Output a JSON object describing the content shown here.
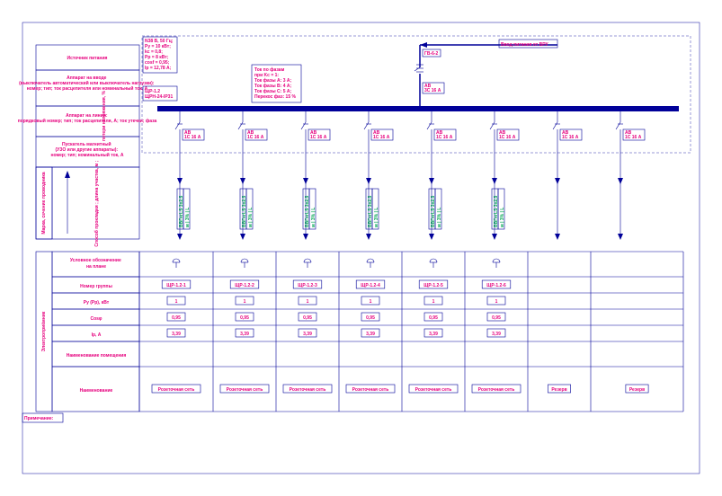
{
  "frame_label": "Примечание:",
  "rows": {
    "r1": "Источник питания",
    "r2": "Аппарат на вводе\n(выключатель автоматический или выключатель нагрузки):\nномер; тип; ток расцепителя или номинальный ток, А",
    "r3": "Аппарат на линии:\nпорядковый номер; тип; ток расцепителя, А; ток утечки; фаза",
    "r4": "Пускатель магнитный\n(УЗО или другие аппараты):\nномер; тип; номинальный ток, А",
    "r5a": "Марка, сечение проводника",
    "r5b": "Способ прокладки ; длина участка, м ;\nпотери напряжения, %",
    "tbl_section": "Электроприёмник",
    "t1": "Условное обозначение\nна плане",
    "t2": "Номер группы",
    "t3": "Ру (Рр), кВт",
    "t4": "Cosφ",
    "t5": "Iр, А",
    "t6": "Наименование помещения",
    "t7": "Наименование"
  },
  "input_block": {
    "l1": "N38 В, 50 Гц;",
    "l2": "Pу = 10 кВт;",
    "l3": "kс = 0,8;",
    "l4": "Pр = 8 кВт;",
    "l5": "cosf = 0,95;",
    "l6": "Iр = 12,78 А;"
  },
  "input_device": {
    "l1": "ЩР-1.2",
    "l2": "ЩРН-24-IP31"
  },
  "phase_block": {
    "l1": "Ток по фазам",
    "l2": "при Kc = 1:",
    "l3": "Ток фазы А: 3 А;",
    "l4": "Ток фазы В: 4 А;",
    "l5": "Ток фазы С: 5 А;",
    "l6": "Перекос фаз: 15 %"
  },
  "feed": {
    "label": "Ввод питания от ВРУ",
    "cable": "ГВ-6-2"
  },
  "breaker": {
    "l1": "АВ",
    "l2": "1С 16 А"
  },
  "cable_tag": {
    "l1": "ВВГнгLS 3х2,5",
    "l2": "м | 3% | L"
  },
  "chart_data": {
    "type": "table",
    "columns": [
      "ЩР-1.2-1",
      "ЩР-1.2-2",
      "ЩР-1.2-3",
      "ЩР-1.2-4",
      "ЩР-1.2-5",
      "ЩР-1.2-6",
      "",
      ""
    ],
    "rows": [
      {
        "name": "Номер группы",
        "values": [
          "ЩР-1.2-1",
          "ЩР-1.2-2",
          "ЩР-1.2-3",
          "ЩР-1.2-4",
          "ЩР-1.2-5",
          "ЩР-1.2-6",
          "",
          ""
        ]
      },
      {
        "name": "Ру (Рр), кВт",
        "values": [
          "1",
          "1",
          "1",
          "1",
          "1",
          "1",
          "",
          ""
        ]
      },
      {
        "name": "Cosφ",
        "values": [
          "0,95",
          "0,95",
          "0,95",
          "0,95",
          "0,95",
          "0,95",
          "",
          ""
        ]
      },
      {
        "name": "Iр, А",
        "values": [
          "3,39",
          "3,39",
          "3,39",
          "3,39",
          "3,39",
          "3,39",
          "",
          ""
        ]
      },
      {
        "name": "Наименование помещения",
        "values": [
          "",
          "",
          "",
          "",
          "",
          "",
          "",
          ""
        ]
      },
      {
        "name": "Наименование",
        "values": [
          "Розеточная сеть",
          "Розеточная сеть",
          "Розеточная сеть",
          "Розеточная сеть",
          "Розеточная сеть",
          "Розеточная сеть",
          "Резерв",
          "Резерв"
        ]
      }
    ]
  },
  "socket_symbol": "⏚"
}
